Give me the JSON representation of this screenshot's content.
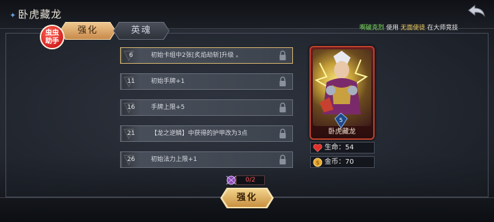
{
  "header": {
    "hero_name": "卧虎藏龙",
    "marquee": {
      "part1": "啊破克烈",
      "part2": "使用",
      "part3": "无面使徒",
      "part4": "在大师竞技"
    }
  },
  "badge": {
    "line1": "虫虫",
    "line2": "助手"
  },
  "tabs": [
    {
      "label": "强化",
      "active": true
    },
    {
      "label": "英魂",
      "active": false
    }
  ],
  "upgrades": [
    {
      "level": "6",
      "text": "初始卡组中2张[炙焰劫斩]升级 。",
      "locked": true
    },
    {
      "level": "11",
      "text": "初始手牌+1",
      "locked": true
    },
    {
      "level": "16",
      "text": "手牌上限+5",
      "locked": true
    },
    {
      "level": "21",
      "text": "【龙之逆鳞】中获得的护甲改为3点",
      "locked": true
    },
    {
      "level": "26",
      "text": "初始法力上限+1",
      "locked": true
    }
  ],
  "card": {
    "name": "卧虎藏龙",
    "level": "5"
  },
  "stats": {
    "hp_label": "生命：54",
    "gold_label": "金币：70"
  },
  "progress": {
    "text": "0/2"
  },
  "upgrade_button": {
    "label": "强化"
  },
  "colors": {
    "accent_gold": "#c88a4a",
    "card_border": "#c0422c",
    "progress_red": "#ff5a5a"
  }
}
